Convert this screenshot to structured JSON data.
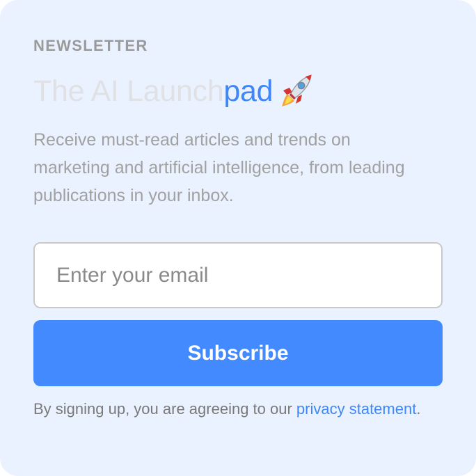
{
  "newsletter": {
    "eyebrow": "NEWSLETTER",
    "title_prefix": "The AI Launch",
    "title_accent": "pad",
    "title_icon": "rocket-icon",
    "description": "Receive must-read articles and trends on marketing and artificial intelligence, from leading publications in your inbox.",
    "email_placeholder": "Enter your email",
    "email_value": "",
    "subscribe_label": "Subscribe",
    "legal_prefix": "By signing up, you are agreeing to our ",
    "privacy_link": "privacy statement",
    "legal_suffix": "."
  },
  "colors": {
    "card_background": "#ebf2ff",
    "accent": "#438aff",
    "title_faded": "#e0e1e4",
    "muted_text": "#a1a1a1"
  }
}
